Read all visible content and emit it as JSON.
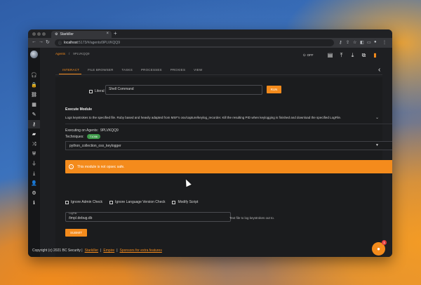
{
  "browser": {
    "tab_title": "Starkiller",
    "url_host": "localhost",
    "url_path": ":5173/#/agents/9PLVKQQ9"
  },
  "breadcrumb": {
    "section": "Agents",
    "separator": "/",
    "current": "9PLVKQQ9"
  },
  "header": {
    "toggle_label": "OFF"
  },
  "tabs": [
    "INTERACT",
    "FILE BROWSER",
    "TASKS",
    "PROCESSES",
    "PROXIES",
    "VIEW"
  ],
  "shell": {
    "literal_label": "Literal",
    "input_placeholder": "Shell Command",
    "run_label": "RUN"
  },
  "module": {
    "title": "Execute Module",
    "description": "Logs keystrokes to the specified file. Ruby based and heavily adapted from MSF's osx/capture/keylog_recorder. Kill the resulting PID when keylogging is finished and download the specified LogFile.",
    "executing_label": "Executing on Agents:",
    "executing_agent": "9PLVKQQ9",
    "techniques_label": "Techniques:",
    "technique_chip": "T1056",
    "selected_module": "python_collection_osx_keylogger",
    "alert": "This module is not opsec safe.",
    "options": [
      "Ignore Admin Check",
      "Ignore Language Version Check",
      "Modify Script"
    ],
    "logfile_label": "LogFile",
    "logfile_value": "/tmp/.debug.db",
    "logfile_help": "Text file to log keystrokes out to.",
    "submit_label": "SUBMIT"
  },
  "footer": {
    "copyright": "Copyright (c) 2021 BC Security |",
    "link1": "Starkiller",
    "sep": "|",
    "link2": "Empire",
    "link3": "Sponsors for extra features"
  },
  "fab_badge": "1",
  "colors": {
    "accent": "#f48b1c",
    "chip": "#3e9a4a",
    "window_bg": "#1e1f22"
  }
}
